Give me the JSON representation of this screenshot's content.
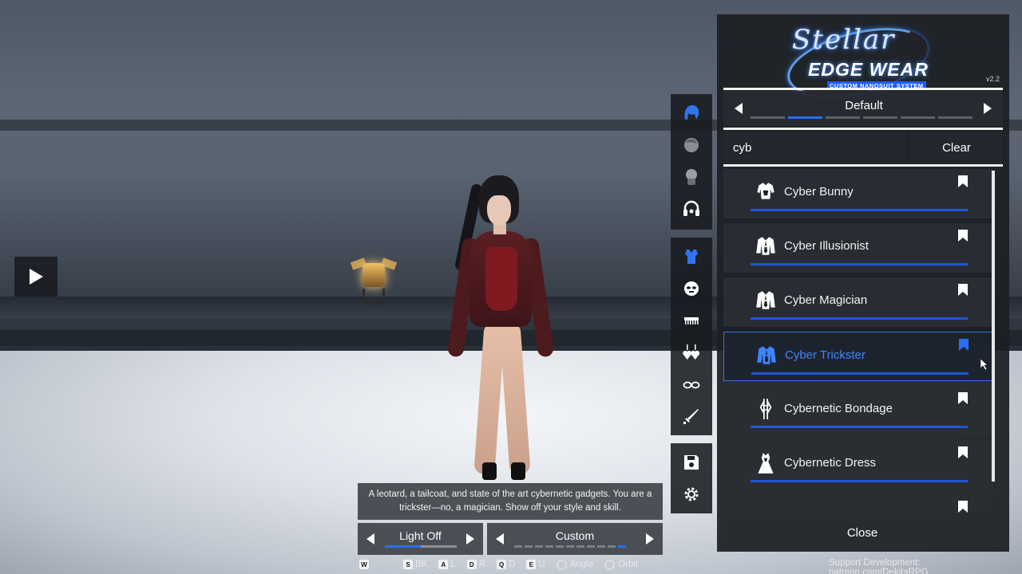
{
  "panel": {
    "logo_script": "Stellar",
    "logo_main": "EDGE WEAR",
    "logo_sub": "CUSTOM NANOSUIT SYSTEM",
    "version": "v2.2",
    "preset": "Default",
    "preset_segments": 6,
    "preset_active_segment": 1,
    "search_value": "cyb",
    "clear_label": "Clear",
    "close_label": "Close",
    "items": [
      {
        "label": "Cyber Bunny",
        "icon": "bodysuit-icon",
        "bookmarked": false,
        "selected": false
      },
      {
        "label": "Cyber Illusionist",
        "icon": "jacket-icon",
        "bookmarked": false,
        "selected": false
      },
      {
        "label": "Cyber Magician",
        "icon": "jacket-icon",
        "bookmarked": false,
        "selected": false
      },
      {
        "label": "Cyber Trickster",
        "icon": "jacket-icon",
        "bookmarked": true,
        "selected": true
      },
      {
        "label": "Cybernetic Bondage",
        "icon": "straps-icon",
        "bookmarked": false,
        "selected": false
      },
      {
        "label": "Cybernetic Dress",
        "icon": "dress-icon",
        "bookmarked": false,
        "selected": false
      }
    ]
  },
  "sidebar": {
    "group1": [
      "hair-icon",
      "face-icon",
      "head-accessory-icon",
      "headphones-icon"
    ],
    "group2": [
      "suit-icon",
      "mask-icon",
      "comb-icon",
      "earrings-icon",
      "glasses-icon",
      "sword-icon"
    ],
    "group3": [
      "save-icon",
      "settings-icon"
    ],
    "active": "suit-icon"
  },
  "bottom": {
    "description": "A leotard, a tailcoat, and state of the art cybernetic gadgets. You are a trickster—no, a magician. Show off your style and skill.",
    "light_label": "Light Off",
    "light_level": 0.5,
    "custom_label": "Custom",
    "custom_segments": 11,
    "custom_active_segment": 10
  },
  "hotkeys": [
    {
      "key": "W",
      "label": ""
    },
    {
      "key": "S",
      "label": "BK"
    },
    {
      "key": "A",
      "label": "L"
    },
    {
      "key": "D",
      "label": "R"
    },
    {
      "key": "Q",
      "label": "D"
    },
    {
      "key": "E",
      "label": "U"
    }
  ],
  "mouse_hints": {
    "angle": "Angle",
    "orbit": "Orbit"
  },
  "support_text": "Support Development: patreon.com/DekitaRPG",
  "colors": {
    "accent": "#2a6ef5",
    "selected_text": "#3d84ff",
    "panel_bg": "#1c1f24"
  }
}
